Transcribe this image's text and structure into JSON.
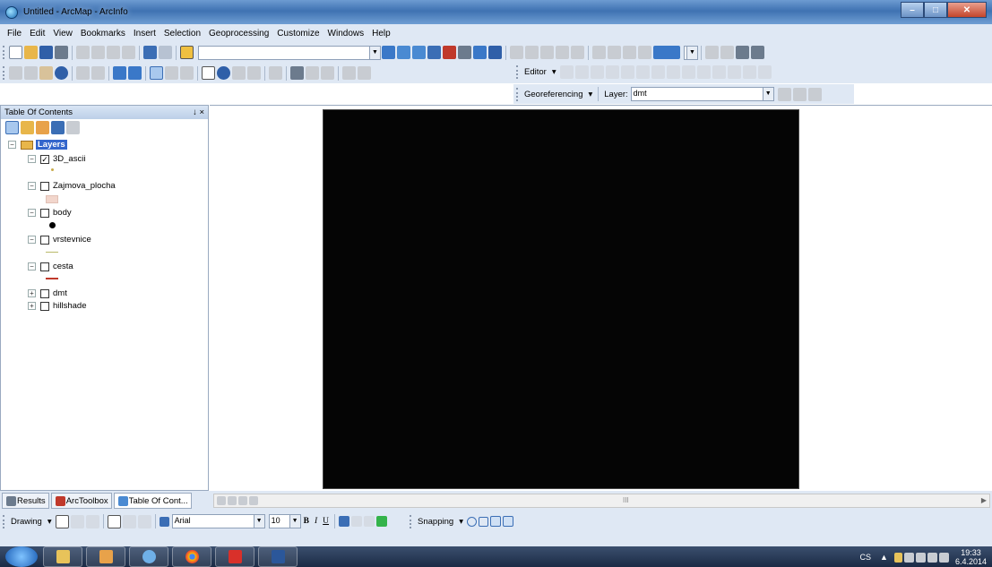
{
  "window": {
    "title": "Untitled - ArcMap - ArcInfo"
  },
  "menu": [
    "File",
    "Edit",
    "View",
    "Bookmarks",
    "Insert",
    "Selection",
    "Geoprocessing",
    "Customize",
    "Windows",
    "Help"
  ],
  "toolbars": {
    "editor_label": "Editor",
    "georef_label": "Georeferencing",
    "layer_label": "Layer:",
    "layer_value": "dmt",
    "drawing_label": "Drawing",
    "font_value": "Arial",
    "font_size": "10",
    "snapping_label": "Snapping"
  },
  "toc": {
    "title": "Table Of Contents",
    "pin": "↓ ×",
    "group": "Layers",
    "layers": [
      {
        "name": "3D_ascii",
        "checked": true
      },
      {
        "name": "Zajmova_plocha",
        "checked": false
      },
      {
        "name": "body",
        "checked": false
      },
      {
        "name": "vrstevnice",
        "checked": false
      },
      {
        "name": "cesta",
        "checked": false
      },
      {
        "name": "dmt",
        "checked": false
      },
      {
        "name": "hillshade",
        "checked": false
      }
    ]
  },
  "bottom_tabs": [
    "Results",
    "ArcToolbox",
    "Table Of Cont..."
  ],
  "scroll_mark": "III",
  "taskbar": {
    "lang": "CS",
    "time": "19:33",
    "date": "6.4.2014"
  },
  "colors": {
    "raster": "#050505",
    "cesta_line": "#c0392b",
    "vrstevnice_line": "#b9b96a",
    "zajmova_fill": "#f2d6cc"
  }
}
